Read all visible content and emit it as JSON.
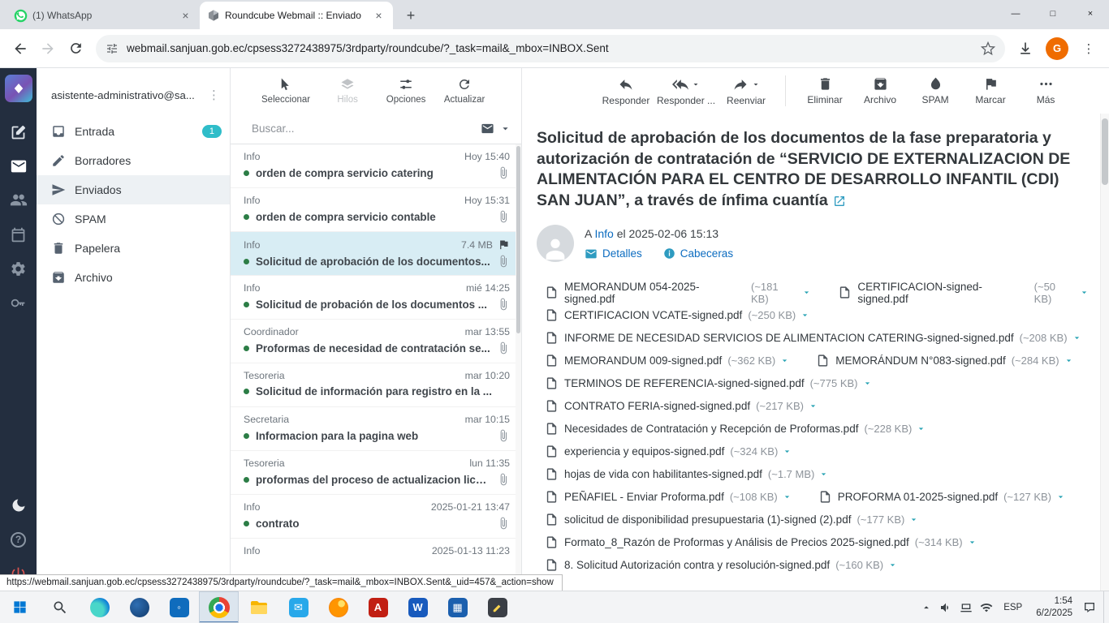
{
  "browser": {
    "tab1": "(1) WhatsApp",
    "tab2": "Roundcube Webmail :: Enviado",
    "url": "webmail.sanjuan.gob.ec/cpsess3272438975/3rdparty/roundcube/?_task=mail&_mbox=INBOX.Sent",
    "profile_initial": "G"
  },
  "status_url": "https://webmail.sanjuan.gob.ec/cpsess3272438975/3rdparty/roundcube/?_task=mail&_mbox=INBOX.Sent&_uid=457&_action=show",
  "icons": {
    "close": "×",
    "new_tab": "+",
    "kebab": "⋮",
    "minimize": "—",
    "maximize": "□",
    "help": "?"
  },
  "sidebar": {
    "account": "asistente-administrativo@sa...",
    "folders": [
      {
        "label": "Entrada",
        "badge": "1"
      },
      {
        "label": "Borradores"
      },
      {
        "label": "Enviados"
      },
      {
        "label": "SPAM"
      },
      {
        "label": "Papelera"
      },
      {
        "label": "Archivo"
      }
    ]
  },
  "list": {
    "toolbar": {
      "select": "Seleccionar",
      "threads": "Hilos",
      "options": "Opciones",
      "refresh": "Actualizar"
    },
    "search_placeholder": "Buscar...",
    "messages": [
      {
        "from": "Info",
        "date": "Hoy 15:40",
        "subject": "orden de compra servicio catering"
      },
      {
        "from": "Info",
        "date": "Hoy 15:31",
        "subject": "orden de compra servicio contable"
      },
      {
        "from": "Info",
        "date": "7.4 MB",
        "subject": "Solicitud de aprobación de los documentos..."
      },
      {
        "from": "Info",
        "date": "mié 14:25",
        "subject": "Solicitud de probación de los documentos ..."
      },
      {
        "from": "Coordinador",
        "date": "mar 13:55",
        "subject": "Proformas de necesidad de contratación se..."
      },
      {
        "from": "Tesoreria",
        "date": "mar 10:20",
        "subject": "Solicitud de información para registro en la ..."
      },
      {
        "from": "Secretaria",
        "date": "mar 10:15",
        "subject": "Informacion para la pagina web"
      },
      {
        "from": "Tesoreria",
        "date": "lun 11:35",
        "subject": "proformas del proceso de actualizacion lice..."
      },
      {
        "from": "Info",
        "date": "2025-01-21 13:47",
        "subject": "contrato"
      },
      {
        "from": "Info",
        "date": "2025-01-13 11:23",
        "subject": ""
      }
    ]
  },
  "view": {
    "toolbar": {
      "reply": "Responder",
      "reply_all": "Responder ...",
      "forward": "Reenviar",
      "delete": "Eliminar",
      "archive": "Archivo",
      "spam": "SPAM",
      "mark": "Marcar",
      "more": "Más"
    },
    "subject": "Solicitud de aprobación de los documentos de la fase preparatoria y autorización de contratación de “SERVICIO DE EXTERNALIZACION DE ALIMENTACIÓN PARA EL CENTRO DE DESARROLLO INFANTIL (CDI) SAN JUAN”, a través de ínfima cuantía",
    "to_prefix": "A",
    "to_name": "Info",
    "date_text": "el 2025-02-06 15:13",
    "details": "Detalles",
    "headers": "Cabeceras",
    "attachments": [
      {
        "name": "MEMORANDUM 054-2025-signed.pdf",
        "size": "(~181 KB)"
      },
      {
        "name": "CERTIFICACION-signed-signed.pdf",
        "size": "(~50 KB)"
      },
      {
        "name": "CERTIFICACION VCATE-signed.pdf",
        "size": "(~250 KB)"
      },
      {
        "name": "INFORME DE NECESIDAD SERVICIOS DE ALIMENTACION CATERING-signed-signed.pdf",
        "size": "(~208 KB)"
      },
      {
        "name": "MEMORANDUM 009-signed.pdf",
        "size": "(~362 KB)"
      },
      {
        "name": "MEMORÁNDUM N°083-signed.pdf",
        "size": "(~284 KB)"
      },
      {
        "name": "TERMINOS DE REFERENCIA-signed-signed.pdf",
        "size": "(~775 KB)"
      },
      {
        "name": "CONTRATO FERIA-signed-signed.pdf",
        "size": "(~217 KB)"
      },
      {
        "name": "Necesidades de Contratación y Recepción de Proformas.pdf",
        "size": "(~228 KB)"
      },
      {
        "name": "experiencia y equipos-signed.pdf",
        "size": "(~324 KB)"
      },
      {
        "name": "hojas de vida con habilitantes-signed.pdf",
        "size": "(~1.7 MB)"
      },
      {
        "name": "PEÑAFIEL - Enviar Proforma.pdf",
        "size": "(~108 KB)"
      },
      {
        "name": "PROFORMA 01-2025-signed.pdf",
        "size": "(~127 KB)"
      },
      {
        "name": "solicitud de disponibilidad presupuestaria (1)-signed (2).pdf",
        "size": "(~177 KB)"
      },
      {
        "name": "Formato_8_Razón de Proformas y Análisis de Precios 2025-signed.pdf",
        "size": "(~314 KB)"
      },
      {
        "name": "8. Solicitud Autorización contra y resolución-signed.pdf",
        "size": "(~160 KB)"
      }
    ]
  },
  "taskbar": {
    "lang": "ESP",
    "time": "1:54",
    "date": "6/2/2025"
  },
  "colors": {
    "accent_teal": "#2fbdc9",
    "link_blue": "#0c6cc0",
    "selected_message_bg": "#d8edf4",
    "unread_dot": "#2c7d46",
    "badge_bg": "#2fbdc9",
    "rail_bg": "#232e3f",
    "profile_avatar": "#ef6c00"
  }
}
